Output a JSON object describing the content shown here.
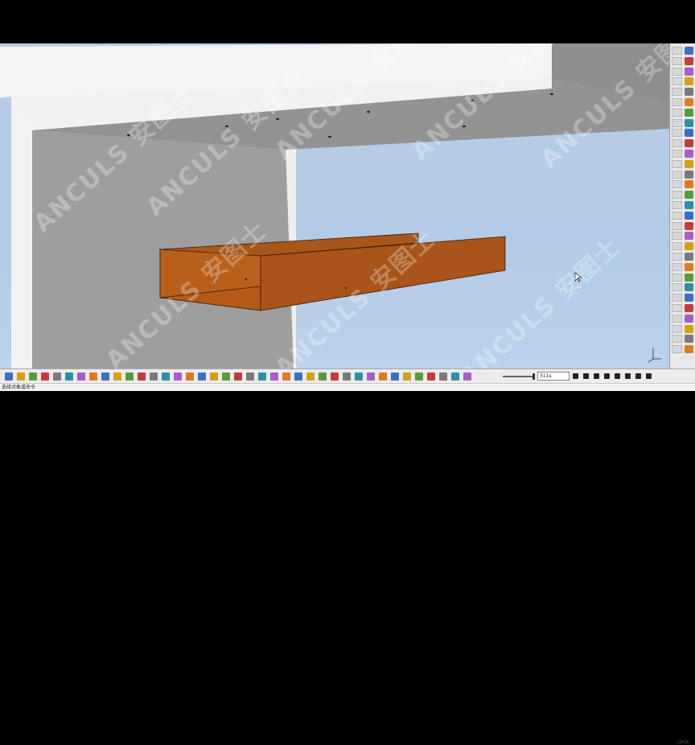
{
  "viewport": {
    "colors": {
      "sky": "#b5cce6",
      "wall": "#9d9d9d",
      "ceiling_face": "#8f8f8f",
      "edge_white": "#f3f3f3",
      "channel": "#a85414",
      "channel_inner": "#e07a20"
    }
  },
  "watermark": {
    "text": "ANCULS 安图士"
  },
  "bottom_toolbar": {
    "speed_field_value": "311s",
    "icons": [
      "new-icon",
      "open-icon",
      "save-icon",
      "print-icon",
      "cut-icon",
      "copy-icon",
      "paste-icon",
      "undo-icon",
      "redo-icon",
      "whats-this-icon",
      "formula-icon",
      "macro-icon",
      "tree-icon",
      "sketch-icon",
      "analysis-icon",
      "measure-icon",
      "fly-icon",
      "fit-all-icon",
      "pan-icon",
      "rotate-icon",
      "zoom-in-icon",
      "zoom-out-icon",
      "normal-view-icon",
      "iso-view-icon",
      "shading-icon",
      "hide-show-icon",
      "swap-icon",
      "capture-icon",
      "compass-icon",
      "analyze-icon",
      "nav-back-icon",
      "search-icon",
      "render-icon",
      "color-icon",
      "material-icon",
      "grid-icon",
      "snap-icon",
      "simulation-icon",
      "arrow-icon"
    ],
    "playback": [
      "first-frame-icon",
      "prev-step-icon",
      "rewind-icon",
      "stop-icon",
      "play-icon",
      "next-step-icon",
      "last-frame-icon",
      "loop-icon"
    ]
  },
  "right_toolbar": {
    "icons": [
      "select-icon",
      "sketch-icon",
      "pad-icon",
      "pocket-icon",
      "hole-icon",
      "shaft-icon",
      "groove-icon",
      "fillet-icon",
      "chamfer-icon",
      "draft-icon",
      "shell-icon",
      "thickness-icon",
      "thread-icon",
      "split-icon",
      "mirror-icon",
      "pattern-icon",
      "scale-icon",
      "boolean-icon",
      "plane-icon",
      "point-icon",
      "line-icon",
      "axis-icon",
      "measure-icon",
      "constraint-icon",
      "material-icon",
      "analysis-icon",
      "render-icon",
      "catalog-icon",
      "parameter-icon",
      "update-icon"
    ]
  },
  "status_bar": {
    "text": "选择对象或命令"
  },
  "catia_label": "CATIA"
}
